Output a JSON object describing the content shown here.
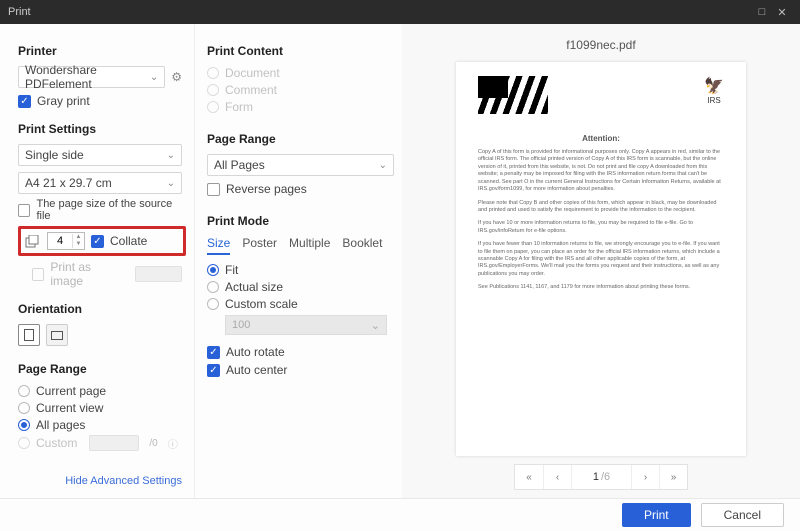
{
  "window": {
    "title": "Print"
  },
  "left": {
    "printer_heading": "Printer",
    "printer_value": "Wondershare PDFelement",
    "gray_print": "Gray print",
    "print_settings_heading": "Print Settings",
    "sides": "Single side",
    "paper": "A4 21 x 29.7 cm",
    "source_size": "The page size of the source file",
    "copies_value": "4",
    "collate": "Collate",
    "print_as_image": "Print as image",
    "orientation_heading": "Orientation",
    "page_range_heading": "Page Range",
    "range": {
      "current_page": "Current page",
      "current_view": "Current view",
      "all_pages": "All pages",
      "custom": "Custom",
      "custom_sep": "/0"
    },
    "hide_advanced": "Hide Advanced Settings"
  },
  "mid": {
    "print_content_heading": "Print Content",
    "content": {
      "document": "Document",
      "comment": "Comment",
      "form": "Form"
    },
    "page_range_heading": "Page Range",
    "all_pages_select": "All Pages",
    "reverse": "Reverse pages",
    "print_mode_heading": "Print Mode",
    "tabs": {
      "size": "Size",
      "poster": "Poster",
      "multiple": "Multiple",
      "booklet": "Booklet"
    },
    "mode_opts": {
      "fit": "Fit",
      "actual": "Actual size",
      "custom_scale": "Custom scale",
      "scale_val": "100"
    },
    "auto_rotate": "Auto rotate",
    "auto_center": "Auto center"
  },
  "right": {
    "filename": "f1099nec.pdf",
    "doc": {
      "attention": "Attention:",
      "p1": "Copy A of this form is provided for informational purposes only. Copy A appears in red, similar to the official IRS form. The official printed version of Copy A of this IRS form is scannable, but the online version of it, printed from this website, is not. Do not print and file copy A downloaded from this website; a penalty may be imposed for filing with the IRS information return forms that can't be scanned. See part O in the current General Instructions for Certain Information Returns, available at IRS.gov/form1099, for more information about penalties.",
      "p2": "Please note that Copy B and other copies of this form, which appear in black, may be downloaded and printed and used to satisfy the requirement to provide the information to the recipient.",
      "p3": "If you have 10 or more information returns to file, you may be required to file e-file. Go to IRS.gov/infoReturn for e-file options.",
      "p4": "If you have fewer than 10 information returns to file, we strongly encourage you to e-file. If you want to file them on paper, you can place an order for the official IRS information returns, which include a scannable Copy A for filing with the IRS and all other applicable copies of the form, at IRS.gov/EmployerForms. We'll mail you the forms you request and their instructions, as well as any publications you may order.",
      "p5": "See Publications 1141, 1167, and 1179 for more information about printing these forms.",
      "irs": "IRS"
    },
    "pager": {
      "first": "«",
      "prev": "‹",
      "current": "1",
      "total": "/6",
      "next": "›",
      "last": "»"
    }
  },
  "footer": {
    "print": "Print",
    "cancel": "Cancel"
  }
}
